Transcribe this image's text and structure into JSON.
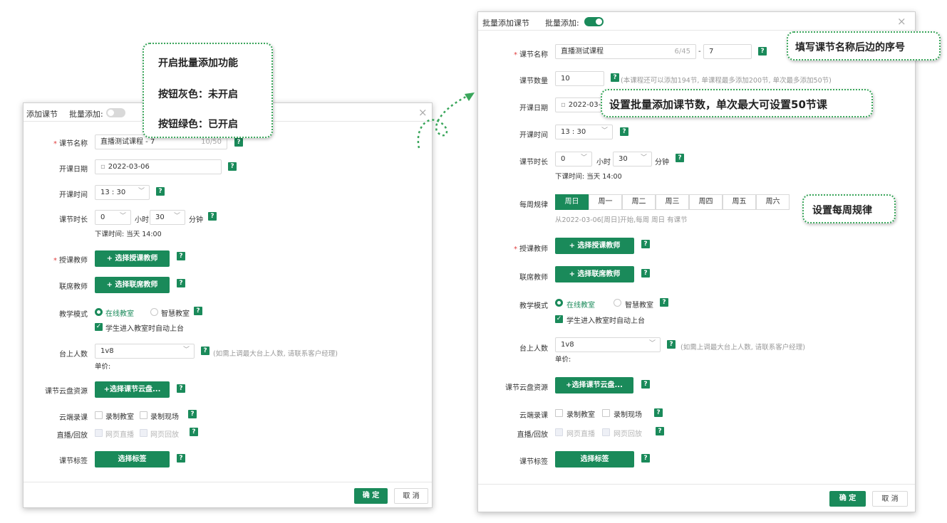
{
  "left_dialog": {
    "title": "添加课节",
    "batch_label": "批量添加:",
    "close_icon": "×",
    "course_name_label": "课节名称",
    "course_name_value": "直播测试课程 - 7",
    "course_name_count": "10/50",
    "date_label": "开课日期",
    "date_value": "2022-03-06",
    "time_label": "开课时间",
    "time_value": "13 : 30",
    "duration_label": "课节时长",
    "duration_hours": "0",
    "hours_unit": "小时",
    "duration_minutes": "30",
    "minutes_unit": "分钟",
    "end_time_text": "下课时间: 当天 14:00",
    "teacher_label": "授课教师",
    "teacher_button": "+ 选择授课教师",
    "co_teacher_label": "联席教师",
    "co_teacher_button": "+ 选择联席教师",
    "mode_label": "教学模式",
    "mode_online": "在线教室",
    "mode_smart": "智慧教室",
    "auto_stage": "学生进入教室时自动上台",
    "stage_label": "台上人数",
    "stage_value": "1v8",
    "stage_hint": "(如需上调最大台上人数, 请联系客户经理)",
    "unit_price": "单价:",
    "cloud_label": "课节云盘资源",
    "cloud_button": "+选择课节云盘...",
    "record_label": "云端录课",
    "record_class": "录制教室",
    "record_site": "录制现场",
    "live_label": "直播/回放",
    "web_live": "网页直播",
    "web_replay": "网页回放",
    "tag_label": "课节标签",
    "tag_button": "选择标签",
    "ok": "确 定",
    "cancel": "取 消"
  },
  "right_dialog": {
    "title": "批量添加课节",
    "batch_label": "批量添加:",
    "close_icon": "×",
    "course_name_label": "课节名称",
    "course_name_value": "直播测试课程",
    "course_name_count": "6/45",
    "dash": "-",
    "seq_value": "7",
    "count_label": "课节数量",
    "count_value": "10",
    "count_hint": "(本课程还可以添加194节, 单课程最多添加200节, 单次最多添加50节)",
    "date_label": "开课日期",
    "date_value": "2022-03-06",
    "time_label": "开课时间",
    "time_value": "13 : 30",
    "duration_label": "课节时长",
    "duration_hours": "0",
    "hours_unit": "小时",
    "duration_minutes": "30",
    "minutes_unit": "分钟",
    "end_time_text": "下课时间: 当天 14:00",
    "week_label": "每周规律",
    "week_days": [
      "周日",
      "周一",
      "周二",
      "周三",
      "周四",
      "周五",
      "周六"
    ],
    "week_hint": "从2022-03-06[周日]开始,每周 周日 有课节",
    "teacher_label": "授课教师",
    "teacher_button": "+ 选择授课教师",
    "co_teacher_label": "联席教师",
    "co_teacher_button": "+ 选择联席教师",
    "mode_label": "教学模式",
    "mode_online": "在线教室",
    "mode_smart": "智慧教室",
    "auto_stage": "学生进入教室时自动上台",
    "stage_label": "台上人数",
    "stage_value": "1v8",
    "stage_hint": "(如需上调最大台上人数, 请联系客户经理)",
    "unit_price": "单价:",
    "cloud_label": "课节云盘资源",
    "cloud_button": "+选择课节云盘...",
    "record_label": "云端录课",
    "record_class": "录制教室",
    "record_site": "录制现场",
    "live_label": "直播/回放",
    "web_live": "网页直播",
    "web_replay": "网页回放",
    "tag_label": "课节标签",
    "tag_button": "选择标签",
    "ok": "确 定",
    "cancel": "取 消"
  },
  "callouts": {
    "toggle_line1": "开启批量添加功能",
    "toggle_line2": "按钮灰色：未开启",
    "toggle_line3": "按钮绿色：已开启",
    "seq": "填写课节名称后边的序号",
    "count": "设置批量添加课节数，单次最大可设置50节课",
    "week": "设置每周规律"
  },
  "help_mark": "?",
  "colors": {
    "accent": "#1a8a5a",
    "callout_border": "#3aa65b"
  }
}
